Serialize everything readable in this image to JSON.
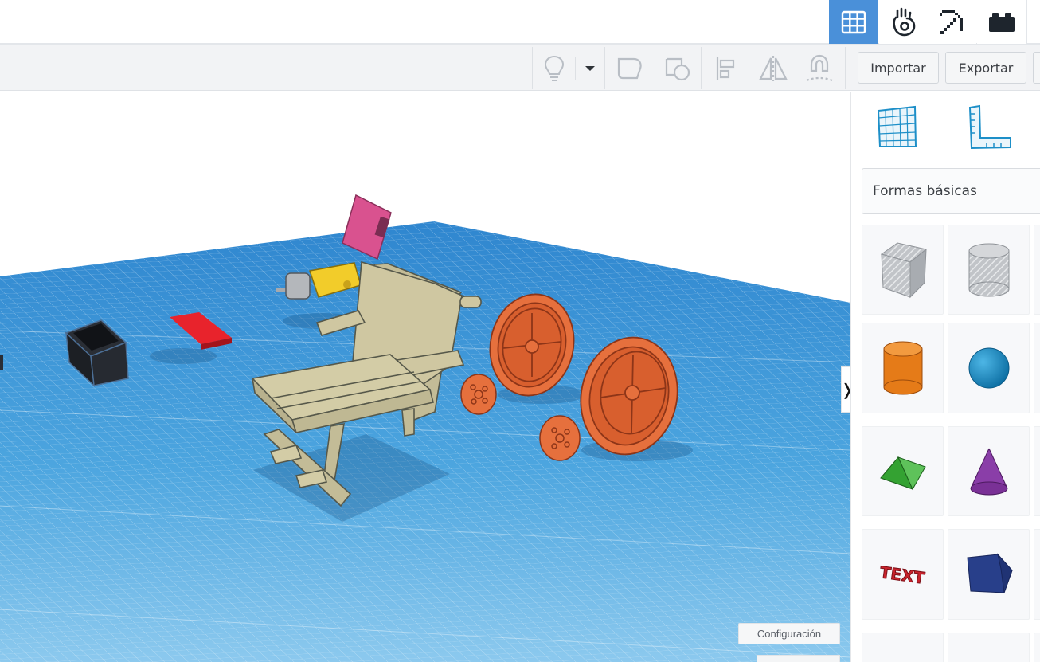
{
  "header": {
    "mode_buttons": [
      {
        "name": "3d-design-view",
        "icon": "grid-icon",
        "active": true
      },
      {
        "name": "blocks-view",
        "icon": "hand-blocks-icon",
        "active": false
      },
      {
        "name": "bricks-view",
        "icon": "pickaxe-icon",
        "active": false
      },
      {
        "name": "lego-view",
        "icon": "brick-icon",
        "active": false
      }
    ]
  },
  "toolbar": {
    "light_bulb_icon": "lightbulb-icon",
    "buttons": [
      "group-icon",
      "ungroup-icon",
      "align-icon",
      "mirror-icon",
      "magnet-icon"
    ],
    "import_label": "Importar",
    "export_label": "Exportar"
  },
  "workplane": {
    "settings_label": "Configuración",
    "toggle_label": "❭",
    "grid_color": "#3f9ad9",
    "objects": [
      "black-box",
      "red-plate",
      "arduino-board",
      "motor",
      "chair",
      "large-wheel",
      "small-wheel",
      "large-wheel-front",
      "small-wheel-front"
    ]
  },
  "panel": {
    "tool_icons": [
      "workplane-icon",
      "ruler-icon"
    ],
    "shapes_dropdown_label": "Formas básicas",
    "shapes": [
      {
        "name": "box-hole",
        "color": "#b9bcc0"
      },
      {
        "name": "cylinder-hole",
        "color": "#c6c9cc"
      },
      {
        "name": "cylinder",
        "color": "#e8821e"
      },
      {
        "name": "sphere",
        "color": "#1e8fc9"
      },
      {
        "name": "roof",
        "color": "#3ca53a"
      },
      {
        "name": "cone",
        "color": "#8a3fa6"
      },
      {
        "name": "text",
        "color": "#c8232c",
        "label": "TEXT"
      },
      {
        "name": "polygon",
        "color": "#283f8a"
      }
    ]
  }
}
